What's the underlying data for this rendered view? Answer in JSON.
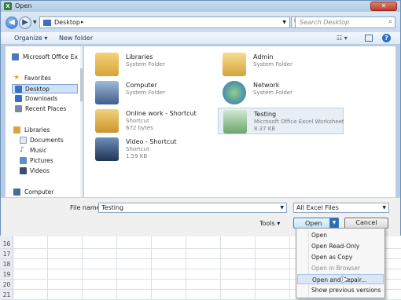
{
  "window": {
    "title": "Open"
  },
  "address": {
    "crumb": "Desktop",
    "search_placeholder": "Search Desktop"
  },
  "toolbar": {
    "organize": "Organize ▾",
    "new_folder": "New folder"
  },
  "nav": {
    "top": "Microsoft Office Ex",
    "favorites_header": "Favorites",
    "favorites": [
      "Desktop",
      "Downloads",
      "Recent Places"
    ],
    "libraries_header": "Libraries",
    "libraries": [
      "Documents",
      "Music",
      "Pictures",
      "Videos"
    ],
    "computer": "Computer"
  },
  "items": [
    {
      "name": "Libraries",
      "type": "System Folder",
      "extra": "",
      "icon": "libraries-folder-icon"
    },
    {
      "name": "Admin",
      "type": "System Folder",
      "extra": "",
      "icon": "user-folder-icon"
    },
    {
      "name": "Computer",
      "type": "System Folder",
      "extra": "",
      "icon": "computer-icon"
    },
    {
      "name": "Network",
      "type": "System Folder",
      "extra": "",
      "icon": "network-globe-icon"
    },
    {
      "name": "Online work - Shortcut",
      "type": "Shortcut",
      "extra": "672 bytes",
      "icon": "shortcut-folder-icon"
    },
    {
      "name": "Testing",
      "type": "Microsoft Office Excel Worksheet",
      "extra": "8.37 KB",
      "icon": "excel-file-icon"
    },
    {
      "name": "Video - Shortcut",
      "type": "Shortcut",
      "extra": "1.59 KB",
      "icon": "video-shortcut-icon"
    }
  ],
  "bottom": {
    "filename_label": "File name:",
    "filename_value": "Testing",
    "filter": "All Excel Files",
    "tools": "Tools",
    "open": "Open",
    "cancel": "Cancel"
  },
  "open_menu": [
    "Open",
    "Open Read-Only",
    "Open as Copy",
    "Open in Browser",
    "Open and Repair...",
    "Show previous versions"
  ],
  "sheet_rows": [
    "16",
    "17",
    "18",
    "19",
    "20",
    "21"
  ],
  "colors": {
    "accent": "#2c6db5",
    "selection": "#cde3fb",
    "frame": "#b7cde6"
  }
}
